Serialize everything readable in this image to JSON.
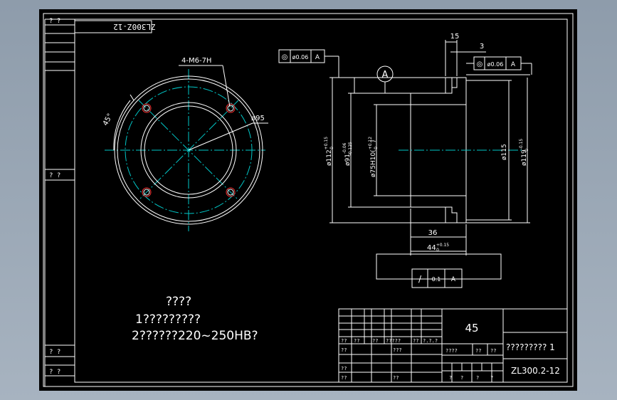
{
  "drawing": {
    "side_labels": [
      "? ?",
      "? ?",
      "? ?",
      "? ?"
    ],
    "title_stamp_mirrored": "ZL300Z-12",
    "front_view": {
      "hole_note": "4-M6-7H",
      "angle_note": "45°",
      "pcd_note": "ø95"
    },
    "section_view": {
      "datum_letter": "A",
      "gdt_left": {
        "symbol": "◎",
        "tolerance": "ø0.06",
        "datum": "A"
      },
      "gdt_right": {
        "symbol": "◎",
        "tolerance": "ø0.06",
        "datum": "A"
      },
      "gdt_bottom": {
        "symbol": "/",
        "tolerance": "0.1",
        "datum": "A"
      },
      "dim_top_15": "15",
      "dim_top_3": "3",
      "dim_d112": "ø112",
      "dim_d112_tol_up": "+0.15",
      "dim_d112_tol_lo": "0",
      "dim_d91": "ø91",
      "dim_d91_tol_up": "-0.06",
      "dim_d91_tol_lo": "-0.125",
      "dim_d75": "ø75H10(",
      "dim_d75_tol": "+0.12",
      "dim_d75_tol_lo": "0",
      "dim_d75_close": ")",
      "dim_d115": "ø115",
      "dim_d119": "ø119",
      "dim_d119_tol_up": "-0.15",
      "dim_d119_tol_lo": "0",
      "dim_36": "36",
      "dim_44": "44",
      "dim_44_tol_up": "+0.15",
      "dim_44_tol_lo": "0"
    },
    "notes": {
      "heading": "????",
      "line1": "1?????????",
      "line2": "2??????220~250HB?"
    },
    "title_block": {
      "material": "45",
      "part_name": "????????? 1",
      "drawing_number": "ZL300.2-12",
      "row_labels_a": [
        "??",
        "??",
        "??",
        "?????",
        "??",
        "?.?.?"
      ],
      "row_b_left": "??",
      "row_b_mid": "???",
      "row_c": [
        "????",
        "??",
        "??"
      ],
      "row_d_left": "??",
      "row_e": [
        "??",
        "??"
      ],
      "row_f": [
        "?",
        "?",
        "?",
        "?"
      ]
    }
  }
}
